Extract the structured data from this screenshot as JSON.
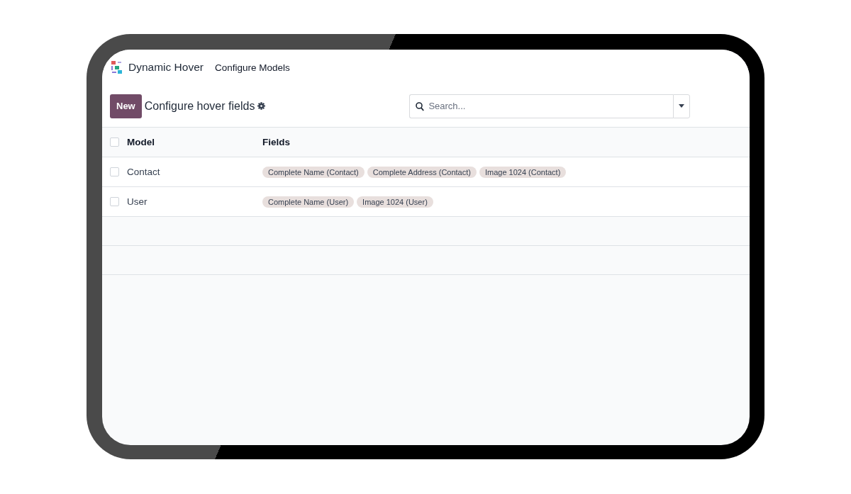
{
  "navbar": {
    "app_name": "Dynamic Hover",
    "menu": [
      {
        "label": "Configure Models"
      }
    ]
  },
  "control_panel": {
    "new_button": "New",
    "title": "Configure hover fields",
    "search": {
      "placeholder": "Search..."
    }
  },
  "table": {
    "select_all": {
      "checked": false
    },
    "columns": [
      "Model",
      "Fields"
    ],
    "rows": [
      {
        "checked": false,
        "model": "Contact",
        "fields": [
          "Complete Name (Contact)",
          "Complete Address (Contact)",
          "Image 1024 (Contact)"
        ]
      },
      {
        "checked": false,
        "model": "User",
        "fields": [
          "Complete Name (User)",
          "Image 1024 (User)"
        ]
      }
    ]
  }
}
